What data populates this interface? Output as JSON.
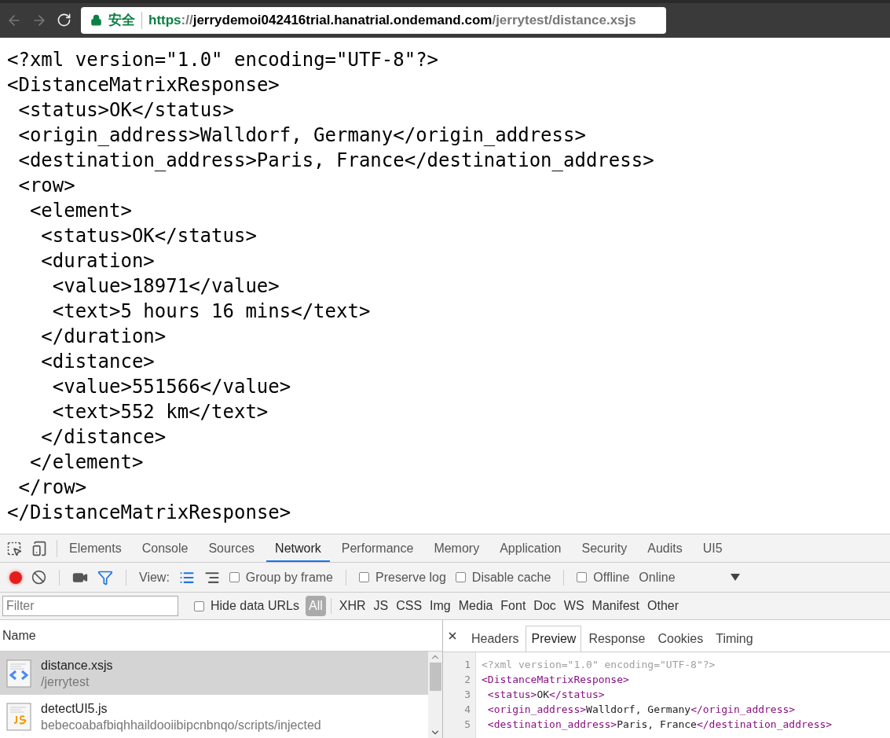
{
  "browser": {
    "back": {
      "disabled": true
    },
    "forward": {
      "disabled": true
    },
    "security_label": "安全",
    "url": {
      "scheme": "https",
      "separator": "://",
      "host": "jerrydemoi042416trial.hanatrial.ondemand.com",
      "path": "/jerrytest/distance.xsjs"
    }
  },
  "document": {
    "declaration": "<?xml version=\"1.0\" encoding=\"UTF-8\"?>",
    "root": {
      "open": "<DistanceMatrixResponse>",
      "close": "</DistanceMatrixResponse>",
      "children": [
        {
          "text": "<status>OK</status>"
        },
        {
          "text": "<origin_address>Walldorf, Germany</origin_address>"
        },
        {
          "text": "<destination_address>Paris, France</destination_address>"
        },
        {
          "open": "<row>",
          "close": "</row>",
          "children": [
            {
              "open": "<element>",
              "close": "</element>",
              "children": [
                {
                  "text": "<status>OK</status>"
                },
                {
                  "open": "<duration>",
                  "close": "</duration>",
                  "children": [
                    {
                      "text": "<value>18971</value>"
                    },
                    {
                      "text": "<text>5 hours 16 mins</text>"
                    }
                  ]
                },
                {
                  "open": "<distance>",
                  "close": "</distance>",
                  "children": [
                    {
                      "text": "<value>551566</value>"
                    },
                    {
                      "text": "<text>552 km</text>"
                    }
                  ]
                }
              ]
            }
          ]
        }
      ]
    }
  },
  "devtools": {
    "tabs": [
      {
        "label": "Elements",
        "selected": false
      },
      {
        "label": "Console",
        "selected": false
      },
      {
        "label": "Sources",
        "selected": false
      },
      {
        "label": "Network",
        "selected": true
      },
      {
        "label": "Performance",
        "selected": false
      },
      {
        "label": "Memory",
        "selected": false
      },
      {
        "label": "Application",
        "selected": false
      },
      {
        "label": "Security",
        "selected": false
      },
      {
        "label": "Audits",
        "selected": false
      },
      {
        "label": "UI5",
        "selected": false
      }
    ],
    "toolbar": {
      "recording": true,
      "filter_active": true,
      "view_label": "View:",
      "views": [
        {
          "kind": "list",
          "selected": true
        },
        {
          "kind": "waterfall",
          "selected": false
        }
      ],
      "options": [
        {
          "label": "Group by frame",
          "checked": false
        },
        {
          "label": "Preserve log",
          "checked": false
        },
        {
          "label": "Disable cache",
          "checked": false
        },
        {
          "label": "Offline",
          "checked": false
        }
      ],
      "throttling": "Online"
    },
    "filter_bar": {
      "placeholder": "Filter",
      "hide_data_urls": {
        "label": "Hide data URLs",
        "checked": false
      },
      "types": [
        {
          "label": "All",
          "selected": true
        },
        {
          "label": "XHR",
          "selected": false
        },
        {
          "label": "JS",
          "selected": false
        },
        {
          "label": "CSS",
          "selected": false
        },
        {
          "label": "Img",
          "selected": false
        },
        {
          "label": "Media",
          "selected": false
        },
        {
          "label": "Font",
          "selected": false
        },
        {
          "label": "Doc",
          "selected": false
        },
        {
          "label": "WS",
          "selected": false
        },
        {
          "label": "Manifest",
          "selected": false
        },
        {
          "label": "Other",
          "selected": false
        }
      ]
    },
    "requests": {
      "column": "Name",
      "rows": [
        {
          "name": "distance.xsjs",
          "path": "/jerrytest",
          "kind": "document",
          "selected": true
        },
        {
          "name": "detectUI5.js",
          "path": "bebecoabafbiqhhaildooiibipcnbnqo/scripts/injected",
          "kind": "script",
          "selected": false
        }
      ]
    },
    "detail": {
      "tabs": [
        {
          "label": "Headers",
          "selected": false
        },
        {
          "label": "Preview",
          "selected": true
        },
        {
          "label": "Response",
          "selected": false
        },
        {
          "label": "Cookies",
          "selected": false
        },
        {
          "label": "Timing",
          "selected": false
        }
      ],
      "lines": [
        {
          "number": "1",
          "segments": [
            {
              "kind": "declaration",
              "text": "<?xml version=\"1.0\" encoding=\"UTF-8\"?>"
            }
          ]
        },
        {
          "number": "2",
          "segments": [
            {
              "kind": "tag",
              "text": "<DistanceMatrixResponse>"
            }
          ]
        },
        {
          "number": "3",
          "segments": [
            {
              "kind": "tag",
              "text": " <status>"
            },
            {
              "kind": "text",
              "text": "OK"
            },
            {
              "kind": "tag",
              "text": "</status>"
            }
          ]
        },
        {
          "number": "4",
          "segments": [
            {
              "kind": "tag",
              "text": " <origin_address>"
            },
            {
              "kind": "text",
              "text": "Walldorf, Germany"
            },
            {
              "kind": "tag",
              "text": "</origin_address>"
            }
          ]
        },
        {
          "number": "5",
          "segments": [
            {
              "kind": "tag",
              "text": " <destination_address>"
            },
            {
              "kind": "text",
              "text": "Paris, France"
            },
            {
              "kind": "tag",
              "text": "</destination_address>"
            }
          ]
        }
      ]
    }
  }
}
